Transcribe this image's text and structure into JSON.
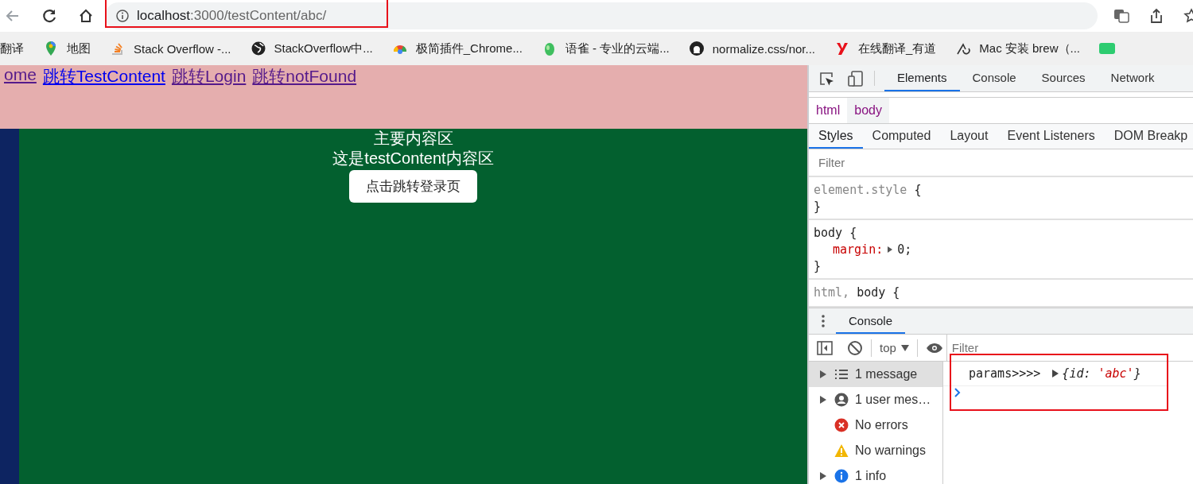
{
  "browser": {
    "address": {
      "host": "localhost",
      "path": ":3000/testContent/abc/",
      "highlighted": true
    }
  },
  "bookmarks": [
    {
      "label": "翻译"
    },
    {
      "label": "地图"
    },
    {
      "label": "Stack Overflow -..."
    },
    {
      "label": "StackOverflow中..."
    },
    {
      "label": "极简插件_Chrome..."
    },
    {
      "label": "语雀 - 专业的云端..."
    },
    {
      "label": "normalize.css/nor..."
    },
    {
      "label": "在线翻译_有道"
    },
    {
      "label": "Mac 安装 brew（..."
    }
  ],
  "page": {
    "nav_links": [
      {
        "label": "ome",
        "visited": true
      },
      {
        "label": "跳转TestContent",
        "visited": false
      },
      {
        "label": "跳转Login",
        "visited": true
      },
      {
        "label": "跳转notFound",
        "visited": true
      }
    ],
    "main": {
      "title": "主要内容区",
      "subtitle": "这是testContent内容区",
      "button": "点击跳转登录页"
    }
  },
  "devtools": {
    "tabs": [
      {
        "label": "Elements",
        "selected": true
      },
      {
        "label": "Console",
        "selected": false
      },
      {
        "label": "Sources",
        "selected": false
      },
      {
        "label": "Network",
        "selected": false
      }
    ],
    "breadcrumbs": [
      {
        "label": "html",
        "selected": false
      },
      {
        "label": "body",
        "selected": true
      }
    ],
    "style_tabs": [
      {
        "label": "Styles",
        "selected": true
      },
      {
        "label": "Computed",
        "selected": false
      },
      {
        "label": "Layout",
        "selected": false
      },
      {
        "label": "Event Listeners",
        "selected": false
      },
      {
        "label": "DOM Breakp",
        "selected": false
      }
    ],
    "filter": {
      "placeholder": "Filter"
    },
    "rules": [
      {
        "selector": [
          {
            "text": "element.style",
            "matched": false
          }
        ],
        "open": "{",
        "close": "}"
      },
      {
        "selector": [
          {
            "text": "body",
            "matched": true
          }
        ],
        "open": "{",
        "declarations": [
          {
            "property": "margin:",
            "value": "0;",
            "expandable": true
          }
        ],
        "close": "}"
      },
      {
        "selector": [
          {
            "text": "html,",
            "matched": false
          },
          {
            "text": "body",
            "matched": true
          }
        ],
        "open": "{"
      }
    ],
    "drawer": {
      "tabs": [
        {
          "label": "Console",
          "selected": true
        }
      ],
      "context": "top",
      "filter": {
        "placeholder": "Filter"
      },
      "sidebar": [
        {
          "kind": "messages",
          "label": "1 message",
          "expandable": true,
          "selected": true
        },
        {
          "kind": "user",
          "label": "1 user mes…",
          "expandable": true,
          "selected": false
        },
        {
          "kind": "errors",
          "label": "No errors",
          "expandable": false,
          "selected": false
        },
        {
          "kind": "warnings",
          "label": "No warnings",
          "expandable": false,
          "selected": false
        },
        {
          "kind": "info",
          "label": "1 info",
          "expandable": true,
          "selected": false
        }
      ],
      "output": {
        "highlighted": true,
        "messages": [
          {
            "text": "params>>>>",
            "open": "{",
            "object": [
              {
                "key": "id:",
                "value": "'abc'"
              }
            ],
            "close": "}"
          }
        ]
      }
    }
  }
}
